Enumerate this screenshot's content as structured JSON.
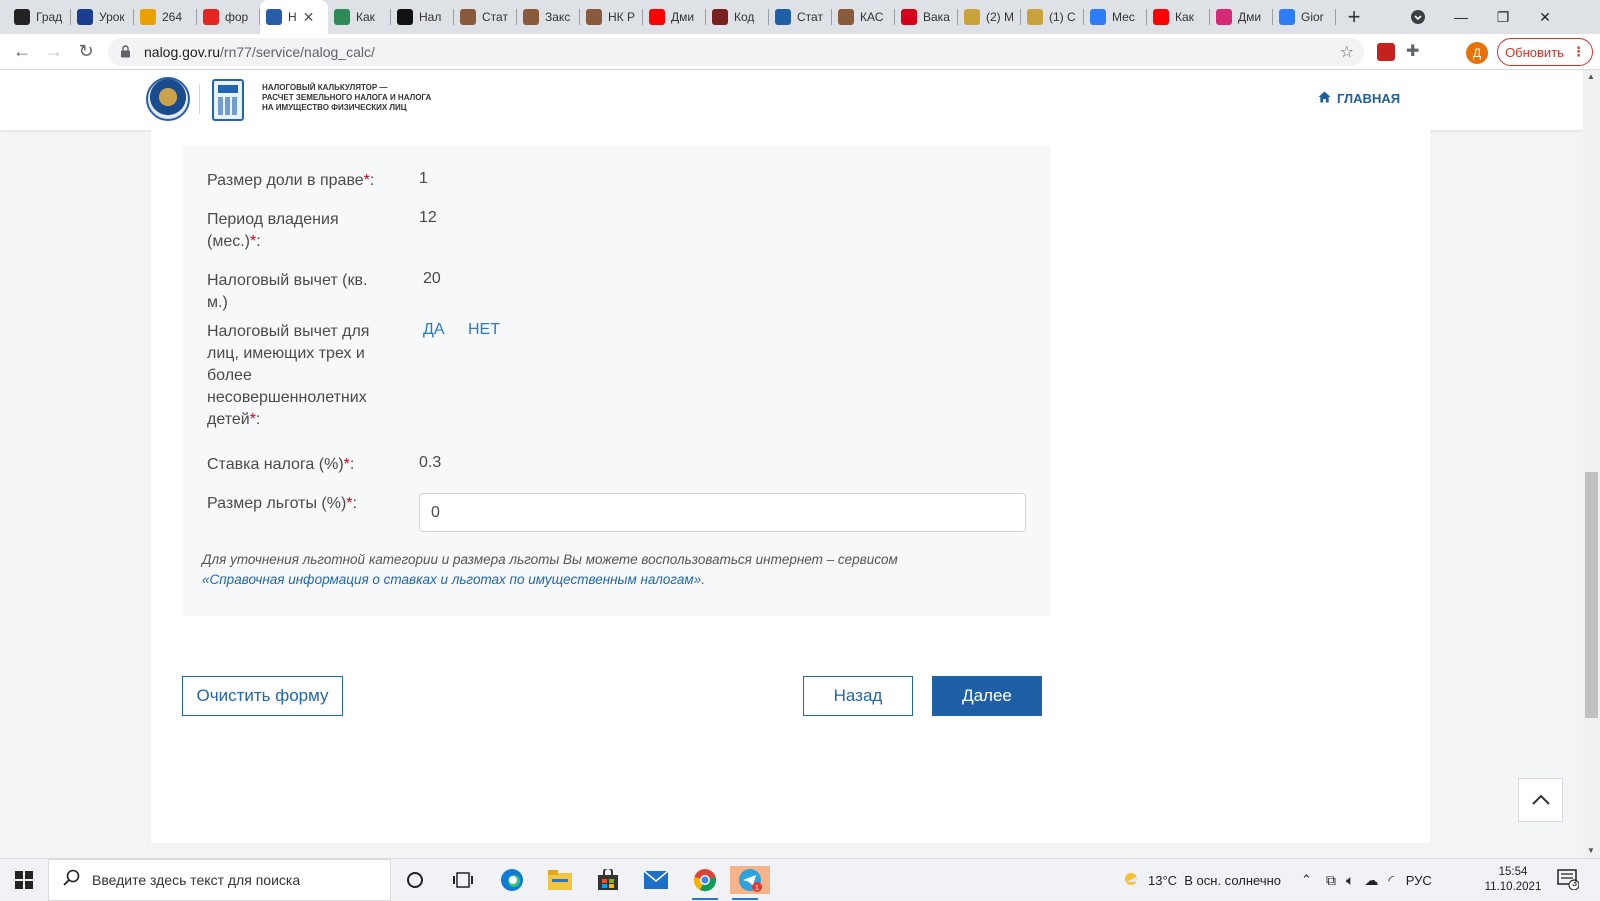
{
  "browser": {
    "tabs": [
      {
        "label": "Град",
        "icon": "inv-icon",
        "color": "#222222"
      },
      {
        "label": "Урок",
        "icon": "uk-flag-icon",
        "color": "#1a3d8f"
      },
      {
        "label": "264",
        "icon": "mail-icon",
        "color": "#e8a100"
      },
      {
        "label": "фор",
        "icon": "yandex-icon",
        "color": "#e52620"
      },
      {
        "label": "Н",
        "icon": "fns-icon",
        "color": "#2a5da8",
        "active": true
      },
      {
        "label": "Как",
        "icon": "hh-green-icon",
        "color": "#2e8b57"
      },
      {
        "label": "Нал",
        "icon": "tj-icon",
        "color": "#111111"
      },
      {
        "label": "Стат",
        "icon": "consultant-icon",
        "color": "#8a5a3c"
      },
      {
        "label": "Закс",
        "icon": "consultant-icon",
        "color": "#8a5a3c"
      },
      {
        "label": "НК Р",
        "icon": "consultant-icon",
        "color": "#8a5a3c"
      },
      {
        "label": "Дми",
        "icon": "youtube-icon",
        "color": "#ff0000"
      },
      {
        "label": "Код",
        "icon": "kodeks-icon",
        "color": "#7a1f1f"
      },
      {
        "label": "Стат",
        "icon": "flag-icon",
        "color": "#1e5fa6"
      },
      {
        "label": "КАС",
        "icon": "consultant-icon",
        "color": "#8a5a3c"
      },
      {
        "label": "Вака",
        "icon": "hh-icon",
        "color": "#d6001c"
      },
      {
        "label": "(2) М",
        "icon": "shield-icon",
        "color": "#c9a23a"
      },
      {
        "label": "(1) С",
        "icon": "shield-icon",
        "color": "#c9a23a"
      },
      {
        "label": "Мес",
        "icon": "pause-icon",
        "color": "#2f7df6"
      },
      {
        "label": "Как",
        "icon": "youtube-icon",
        "color": "#ff0000"
      },
      {
        "label": "Дми",
        "icon": "instagram-icon",
        "color": "#d62976"
      },
      {
        "label": "Gior",
        "icon": "pause-icon",
        "color": "#2f7df6"
      }
    ],
    "url_host": "nalog.gov.ru",
    "url_path": "/rn77/service/nalog_calc/",
    "avatar_letter": "Д",
    "update_label": "Обновить"
  },
  "header": {
    "site_title_line1": "НАЛОГОВЫЙ КАЛЬКУЛЯТОР —",
    "site_title_line2": "РАСЧЕТ ЗЕМЕЛЬНОГО НАЛОГА И НАЛОГА",
    "site_title_line3": "НА ИМУЩЕСТВО ФИЗИЧЕСКИХ ЛИЦ",
    "home_label": "ГЛАВНАЯ"
  },
  "form": {
    "share": {
      "label": "Размер доли в праве",
      "value": "1"
    },
    "period": {
      "label_line1": "Период владения",
      "label_line2": "(мес.)",
      "value": "12"
    },
    "deduction": {
      "label_line1": "Налоговый вычет (кв.",
      "label_line2": "м.)",
      "value": "20"
    },
    "children_deduction": {
      "label_line1": "Налоговый вычет для",
      "label_line2": "лиц, имеющих трех и",
      "label_line3": "более",
      "label_line4": "несовершеннолетних",
      "label_line5": "детей",
      "yes": "ДА",
      "no": "НЕТ"
    },
    "rate": {
      "label": "Ставка налога (%)",
      "value": "0.3"
    },
    "benefit": {
      "label": "Размер льготы (%)",
      "value": "0"
    },
    "required_mark": "*",
    "colon": ":",
    "note_text": "Для уточнения льготной категории и размера льготы Вы можете воспользоваться интернет – сервисом",
    "note_link": "«Справочная информация о ставках и льготах по имущественным налогам»",
    "note_end": "."
  },
  "buttons": {
    "clear": "Очистить форму",
    "back": "Назад",
    "next": "Далее"
  },
  "taskbar": {
    "search_placeholder": "Введите здесь текст для поиска",
    "weather": "13°C  В осн. солнечно",
    "lang": "РУС",
    "time": "15:54",
    "date": "11.10.2021",
    "notifications": "3"
  },
  "colors": {
    "accent": "#1e5fa6",
    "link": "#2a79c9",
    "required": "#d0021b",
    "update": "#d93025"
  }
}
